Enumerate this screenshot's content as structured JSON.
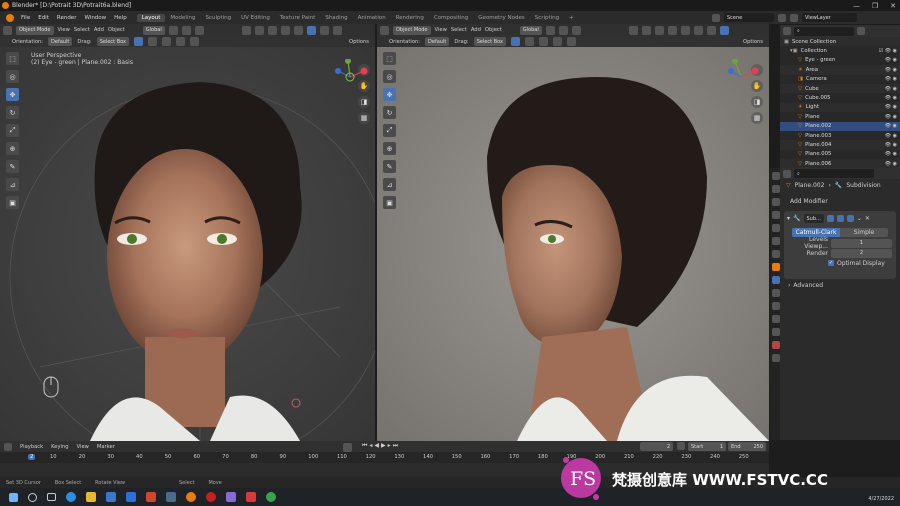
{
  "window": {
    "title": "Blender* [D:\\Potrait 3D\\Potrait6a.blend]",
    "controls": [
      "—",
      "❐",
      "✕"
    ]
  },
  "menu": {
    "items": [
      "File",
      "Edit",
      "Render",
      "Window",
      "Help"
    ]
  },
  "workspaces": {
    "tabs": [
      "Layout",
      "Modeling",
      "Sculpting",
      "UV Editing",
      "Texture Paint",
      "Shading",
      "Animation",
      "Rendering",
      "Compositing",
      "Geometry Nodes",
      "Scripting"
    ],
    "active": "Layout",
    "add": "+"
  },
  "scene": {
    "label": "Scene"
  },
  "view_layer": {
    "label": "ViewLayer"
  },
  "viewport_left": {
    "mode": "Object Mode",
    "menus": [
      "View",
      "Select",
      "Add",
      "Object"
    ],
    "transform": "Global",
    "orientation_label": "Orientation:",
    "orientation_value": "Default",
    "drag_label": "Drag:",
    "drag_value": "Select Box",
    "options": "Options",
    "perspective": "User Perspective",
    "object_info": "(2) Eye - green | Plane.002 : Basis"
  },
  "viewport_right": {
    "mode": "Object Mode",
    "menus": [
      "View",
      "Select",
      "Add",
      "Object"
    ],
    "transform": "Global",
    "orientation_label": "Orientation:",
    "orientation_value": "Default",
    "drag_label": "Drag:",
    "drag_value": "Select Box",
    "options": "Options"
  },
  "outliner": {
    "root": "Scene Collection",
    "collection": "Collection",
    "items": [
      "Eye - green",
      "Area",
      "Camera",
      "Cube",
      "Cube.005",
      "Light",
      "Plane",
      "Plane.002",
      "Plane.003",
      "Plane.004",
      "Plane.005",
      "Plane.006"
    ],
    "selected": "Plane.002"
  },
  "properties": {
    "object": "Plane.002",
    "modifier_name_field": "Subdivision",
    "add_modifier": "Add Modifier",
    "modifier_short": "Sub...",
    "algo_active": "Catmull-Clark",
    "algo_other": "Simple",
    "levels_label": "Levels Viewp...",
    "levels_value": "1",
    "render_label": "Render",
    "render_value": "2",
    "optimal_label": "Optimal Display",
    "advanced": "Advanced"
  },
  "timeline": {
    "menus": [
      "Playback",
      "Keying",
      "View",
      "Marker"
    ],
    "current_frame": "2",
    "start_label": "Start",
    "start_value": "1",
    "end_label": "End",
    "end_value": "250",
    "ticks": [
      "2",
      "10",
      "20",
      "30",
      "40",
      "50",
      "60",
      "70",
      "80",
      "90",
      "100",
      "110",
      "120",
      "130",
      "140",
      "150",
      "160",
      "170",
      "180",
      "190",
      "200",
      "210",
      "220",
      "230",
      "240",
      "250"
    ]
  },
  "statusbar": {
    "items": [
      "Set 3D Cursor",
      "Box Select",
      "Rotate View",
      "Select",
      "Move"
    ]
  },
  "taskbar": {
    "date": "4/27/2022"
  },
  "watermark": {
    "logo_text": "FS",
    "text": "梵摄创意库 WWW.FSTVC.CC"
  },
  "colors": {
    "accent": "#4772b3",
    "blender_orange": "#e87d0d",
    "watermark_pink": "#c43aa8"
  }
}
